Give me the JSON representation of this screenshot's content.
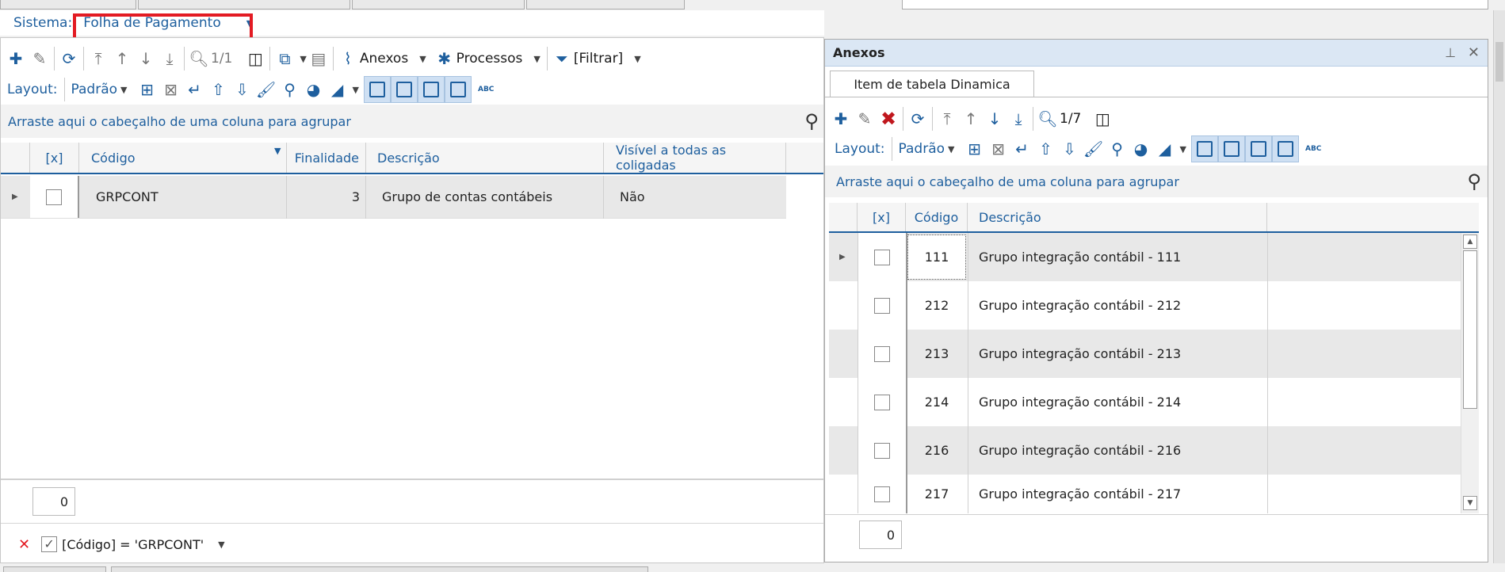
{
  "sistema": {
    "label": "Sistema:",
    "value": "Folha de Pagamento"
  },
  "main": {
    "toolbar": {
      "page": "1/1",
      "anexos": "Anexos",
      "processos": "Processos",
      "filtrar": "[Filtrar]"
    },
    "layout": {
      "label": "Layout:",
      "value": "Padrão"
    },
    "group_hint": "Arraste aqui o cabeçalho de uma coluna para agrupar",
    "columns": [
      "[x]",
      "Código",
      "Finalidade",
      "Descrição",
      "Visível a todas as coligadas"
    ],
    "rows": [
      {
        "codigo": "GRPCONT",
        "finalidade": "3",
        "descricao": "Grupo de contas contábeis",
        "visivel": "Não"
      }
    ],
    "count": "0",
    "filter_text": "[Código] = 'GRPCONT'"
  },
  "anexos": {
    "title": "Anexos",
    "tab": "Item de tabela Dinamica",
    "toolbar": {
      "page": "1/7"
    },
    "layout": {
      "label": "Layout:",
      "value": "Padrão"
    },
    "group_hint": "Arraste aqui o cabeçalho de uma coluna para agrupar",
    "columns": [
      "[x]",
      "Código",
      "Descrição"
    ],
    "rows": [
      {
        "codigo": "111",
        "descricao": "Grupo integração contábil - 111"
      },
      {
        "codigo": "212",
        "descricao": "Grupo integração contábil - 212"
      },
      {
        "codigo": "213",
        "descricao": "Grupo integração contábil - 213"
      },
      {
        "codigo": "214",
        "descricao": "Grupo integração contábil - 214"
      },
      {
        "codigo": "216",
        "descricao": "Grupo integração contábil - 216"
      },
      {
        "codigo": "217",
        "descricao": "Grupo integração contábil - 217"
      }
    ],
    "count": "0"
  },
  "colors": {
    "accent": "#1e5f9e",
    "highlight": "#e31b23",
    "panel_header": "#dbe7f4"
  }
}
